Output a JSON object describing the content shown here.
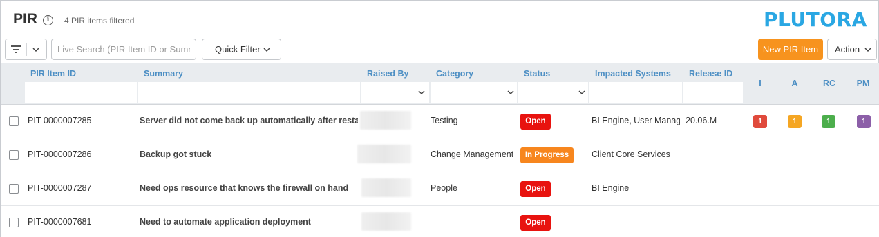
{
  "header": {
    "title": "PIR",
    "info_icon": "info-icon",
    "count_text": "4 PIR items filtered",
    "logo_text": "PLUTORA"
  },
  "toolbar": {
    "filter_icon": "filter-icon",
    "search_placeholder": "Live Search (PIR Item ID or Summary)",
    "quick_filter_label": "Quick Filter",
    "new_item_label": "New PIR Item",
    "action_label": "Action"
  },
  "columns": {
    "id": "PIR Item ID",
    "summary": "Summary",
    "raised_by": "Raised By",
    "category": "Category",
    "status": "Status",
    "impacted": "Impacted Systems",
    "release": "Release ID",
    "i": "I",
    "a": "A",
    "rc": "RC",
    "pm": "PM"
  },
  "rows": [
    {
      "id": "PIT-0000007285",
      "summary": "Server did not come back up automatically after restart",
      "category": "Testing",
      "status": "Open",
      "impacted": "BI Engine, User Management",
      "release": "20.06.M",
      "i": "1",
      "a": "1",
      "rc": "1",
      "pm": "1"
    },
    {
      "id": "PIT-0000007286",
      "summary": "Backup got stuck",
      "category": "Change Management",
      "status": "In Progress",
      "impacted": "Client Core Services",
      "release": ""
    },
    {
      "id": "PIT-0000007287",
      "summary": "Need ops resource that knows the firewall on hand",
      "category": "People",
      "status": "Open",
      "impacted": "BI Engine",
      "release": ""
    },
    {
      "id": "PIT-0000007681",
      "summary": "Need to automate application deployment",
      "category": "",
      "status": "Open",
      "impacted": "",
      "release": ""
    }
  ],
  "colors": {
    "brand": "#2aa7e3",
    "accent": "#f7931e",
    "header_label": "#4d8fc4",
    "status_open": "#e8130f",
    "status_in_progress": "#f7861e",
    "pill_i": "#e04a3c",
    "pill_a": "#f5a623",
    "pill_rc": "#4cae4c",
    "pill_pm": "#8c5fa8"
  }
}
